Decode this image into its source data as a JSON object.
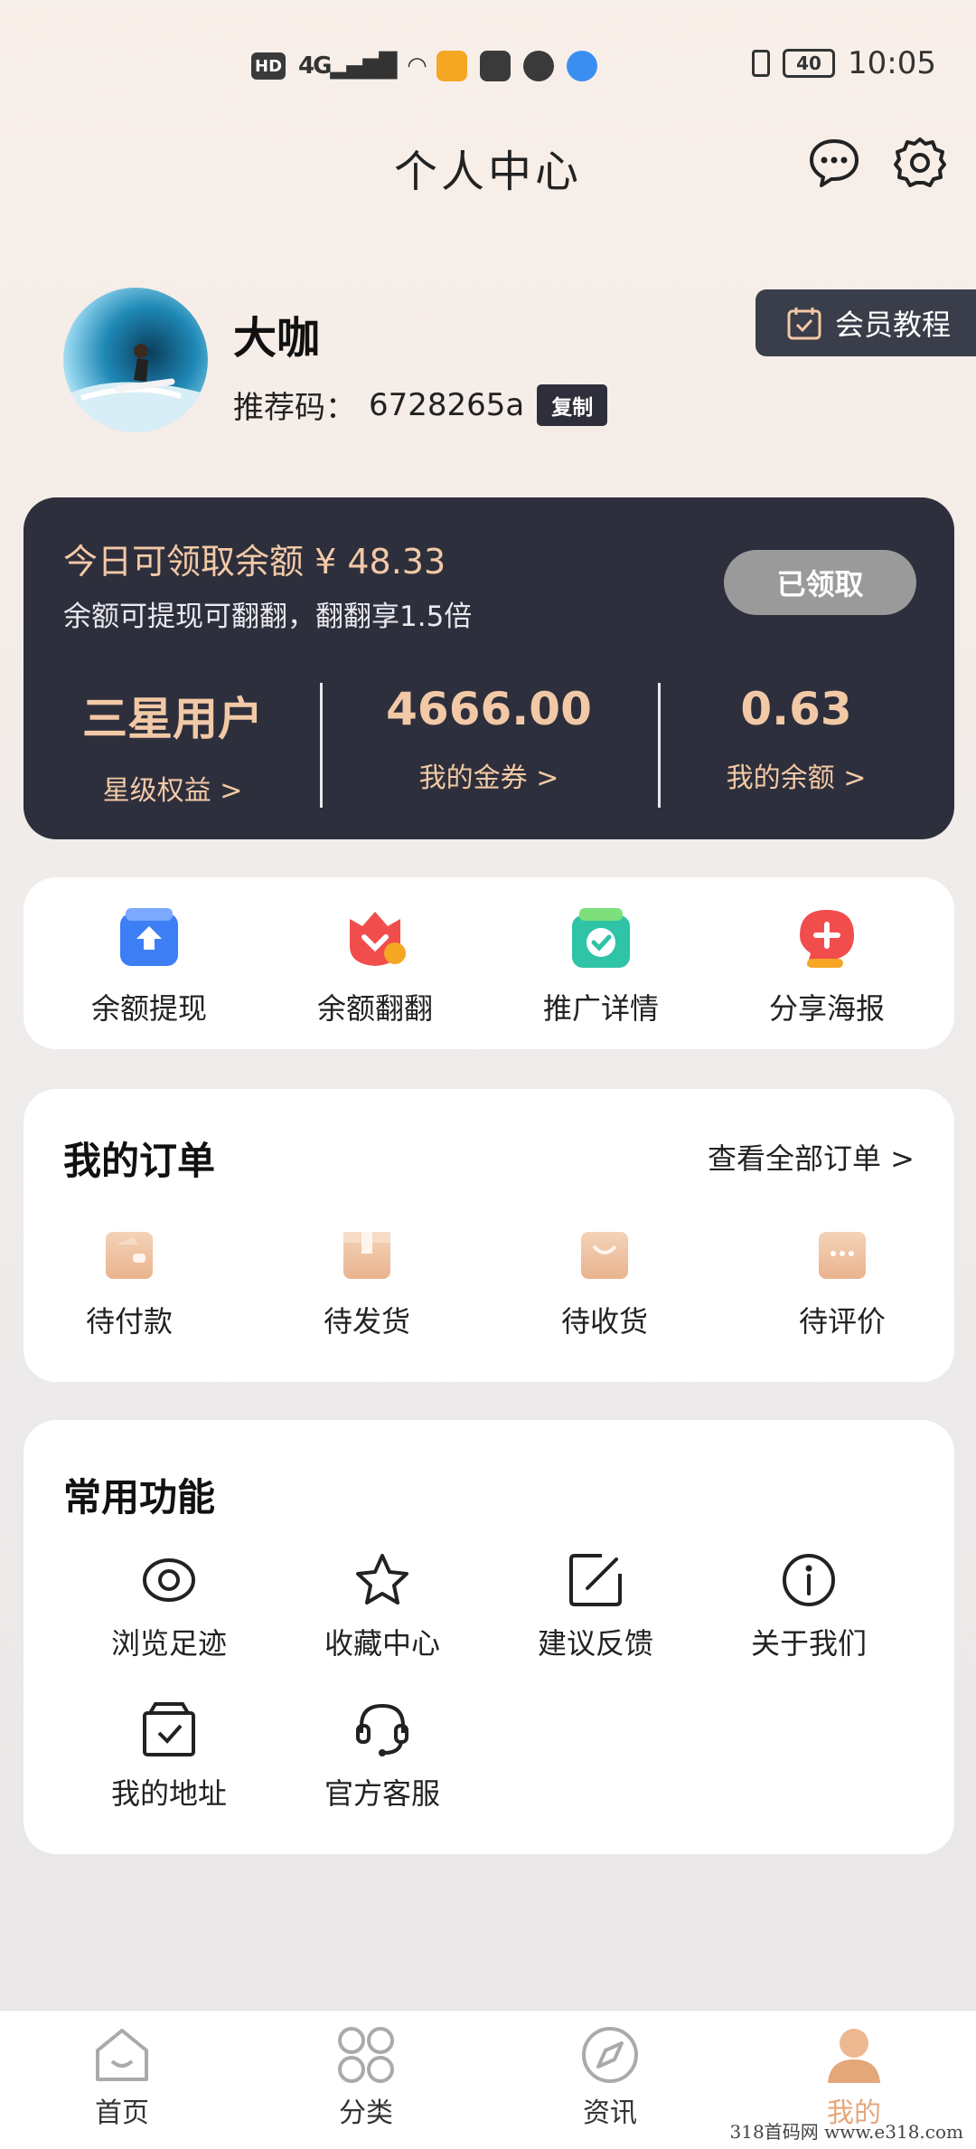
{
  "status_bar": {
    "network_badge": "HD",
    "signal": "4G",
    "battery": "40",
    "time": "10:05"
  },
  "header": {
    "title": "个人中心"
  },
  "profile": {
    "name": "大咖",
    "referral_label": "推荐码：",
    "referral_code": "6728265a",
    "copy_label": "复制",
    "member_tutorial": "会员教程"
  },
  "balance_card": {
    "title": "今日可领取余额 ¥ 48.33",
    "subtitle": "余额可提现可翻翻，翻翻享1.5倍",
    "claimed_label": "已领取",
    "stats": [
      {
        "value": "三星用户",
        "label": "星级权益 >"
      },
      {
        "value": "4666.00",
        "label": "我的金券 >"
      },
      {
        "value": "0.63",
        "label": "我的余额 >"
      }
    ]
  },
  "quick_actions": [
    {
      "label": "余额提现",
      "icon": "withdraw-icon",
      "color": "#3d7ef5"
    },
    {
      "label": "余额翻翻",
      "icon": "flip-icon",
      "color": "#f14d4d"
    },
    {
      "label": "推广详情",
      "icon": "promotion-icon",
      "color": "#2fc3a7"
    },
    {
      "label": "分享海报",
      "icon": "share-poster-icon",
      "color": "#f14d4d"
    }
  ],
  "orders": {
    "title": "我的订单",
    "view_all": "查看全部订单 >",
    "items": [
      {
        "label": "待付款",
        "icon": "wallet-icon"
      },
      {
        "label": "待发货",
        "icon": "package-icon"
      },
      {
        "label": "待收货",
        "icon": "bag-icon"
      },
      {
        "label": "待评价",
        "icon": "comment-icon"
      }
    ]
  },
  "functions": {
    "title": "常用功能",
    "items": [
      {
        "label": "浏览足迹",
        "icon": "eye-icon"
      },
      {
        "label": "收藏中心",
        "icon": "star-icon"
      },
      {
        "label": "建议反馈",
        "icon": "edit-icon"
      },
      {
        "label": "关于我们",
        "icon": "info-icon"
      },
      {
        "label": "我的地址",
        "icon": "address-box-icon"
      },
      {
        "label": "官方客服",
        "icon": "headset-icon"
      }
    ]
  },
  "tabbar": [
    {
      "label": "首页",
      "icon": "home-icon",
      "active": false
    },
    {
      "label": "分类",
      "icon": "category-icon",
      "active": false
    },
    {
      "label": "资讯",
      "icon": "compass-icon",
      "active": false
    },
    {
      "label": "我的",
      "icon": "profile-icon",
      "active": true
    }
  ],
  "colors": {
    "accent_gold": "#f2c9a6",
    "dark_card": "#2e2f3c",
    "active_tab": "#e4a77a"
  },
  "watermark": "318首码网  www.e318.com"
}
